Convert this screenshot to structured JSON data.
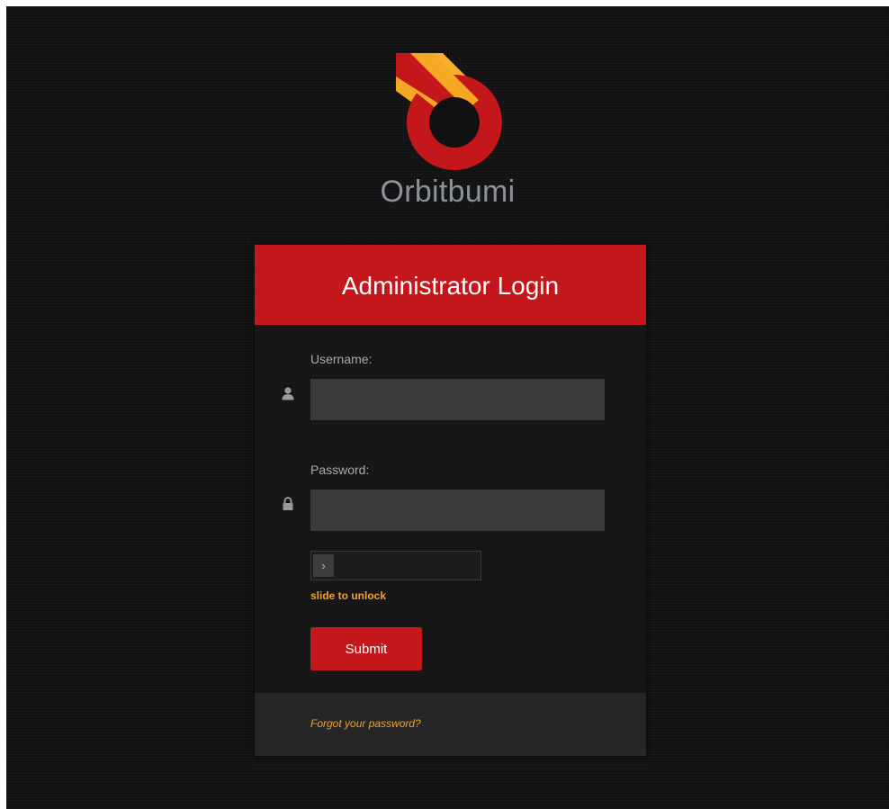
{
  "brand": {
    "name": "Orbitbumi",
    "logo_icon": "orbitbumi-logo-icon",
    "colors": {
      "red": "#c3171c",
      "orange": "#f7a823",
      "dark": "#111111"
    }
  },
  "login_card": {
    "title": "Administrator Login",
    "username": {
      "label": "Username:",
      "value": "",
      "icon": "user-icon"
    },
    "password": {
      "label": "Password:",
      "value": "",
      "icon": "lock-icon"
    },
    "slider": {
      "handle_glyph": "›",
      "text": "slide to unlock",
      "progress": 0
    },
    "submit_label": "Submit",
    "forgot_password_label": "Forgot your password?"
  }
}
